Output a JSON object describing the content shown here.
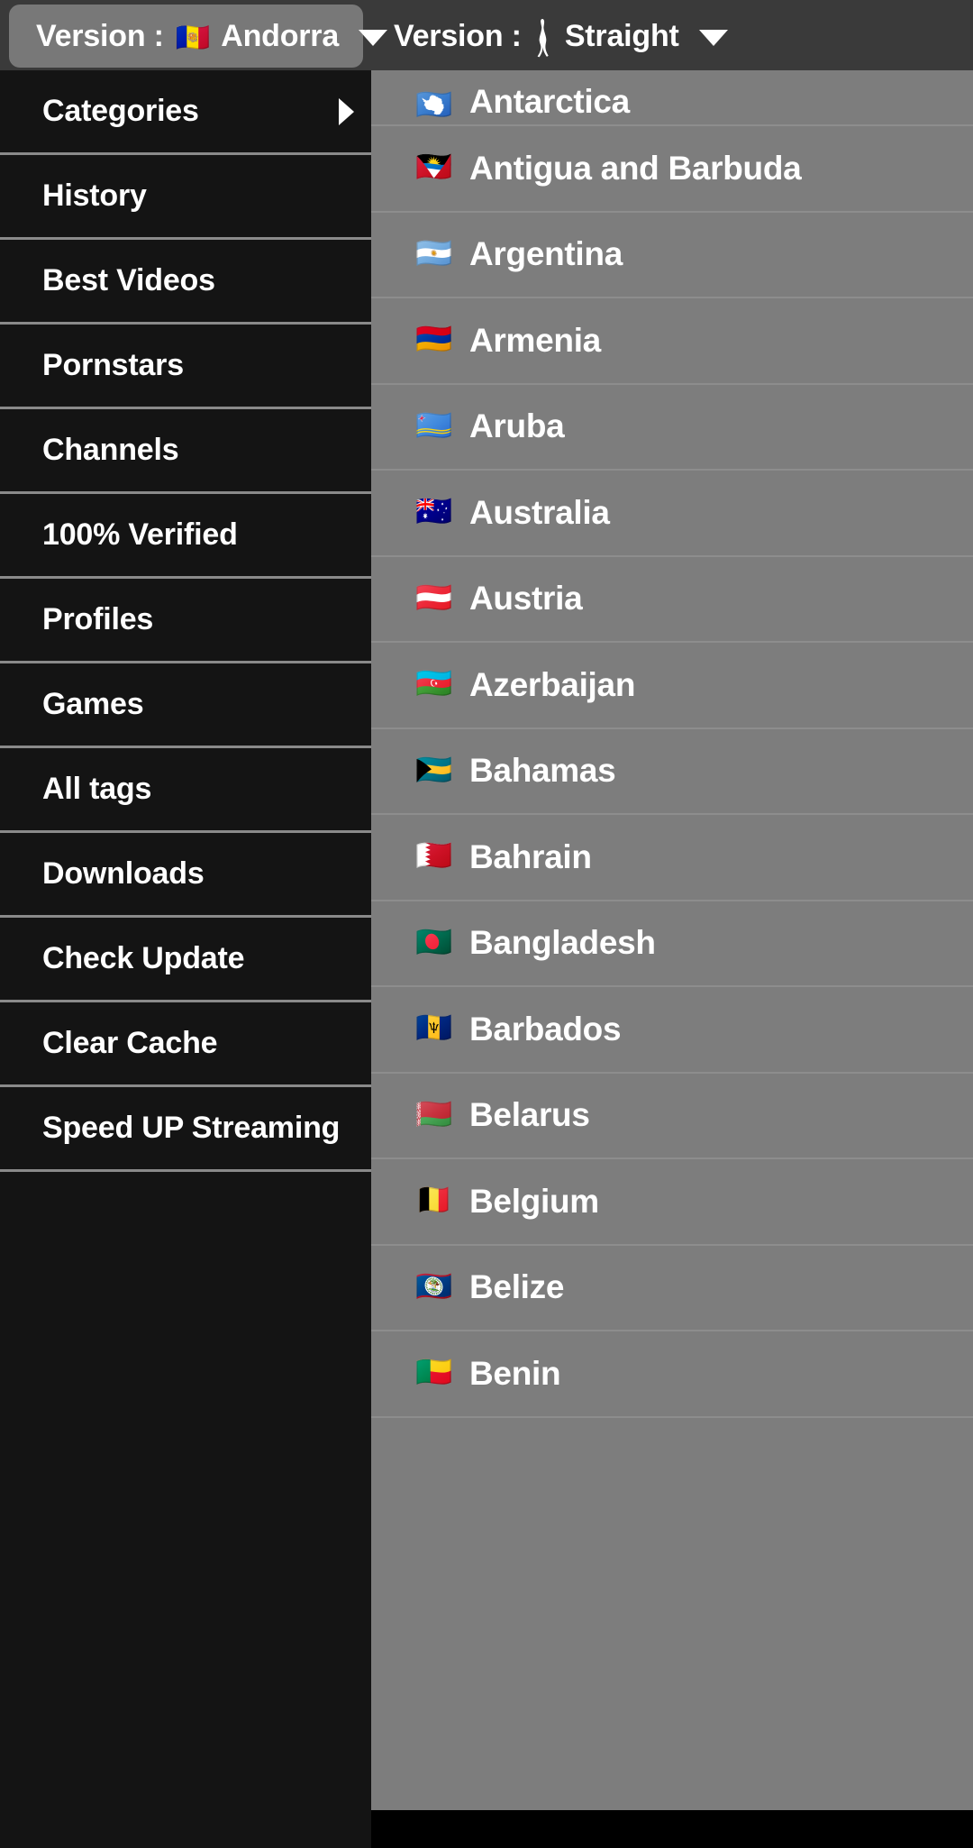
{
  "header": {
    "version_country": {
      "label": "Version :",
      "flag": "🇦🇩",
      "value": "Andorra",
      "caret": "chevron-down-icon"
    },
    "version_orientation": {
      "label": "Version :",
      "icon": "person-standing-icon",
      "value": "Straight",
      "caret": "chevron-down-icon"
    }
  },
  "sidebar": {
    "items": [
      {
        "label": "Categories",
        "has_submenu": true
      },
      {
        "label": "History",
        "has_submenu": false
      },
      {
        "label": "Best Videos",
        "has_submenu": false
      },
      {
        "label": "Pornstars",
        "has_submenu": false
      },
      {
        "label": "Channels",
        "has_submenu": false
      },
      {
        "label": "100% Verified",
        "has_submenu": false
      },
      {
        "label": "Profiles",
        "has_submenu": false
      },
      {
        "label": "Games",
        "has_submenu": false
      },
      {
        "label": "All tags",
        "has_submenu": false
      },
      {
        "label": "Downloads",
        "has_submenu": false
      },
      {
        "label": "Check Update",
        "has_submenu": false
      },
      {
        "label": "Clear Cache",
        "has_submenu": false
      },
      {
        "label": "Speed UP Streaming",
        "has_submenu": false
      }
    ]
  },
  "country_list": {
    "countries": [
      {
        "flag": "🇦🇶",
        "name": "Antarctica"
      },
      {
        "flag": "🇦🇬",
        "name": "Antigua and Barbuda"
      },
      {
        "flag": "🇦🇷",
        "name": "Argentina"
      },
      {
        "flag": "🇦🇲",
        "name": "Armenia"
      },
      {
        "flag": "🇦🇼",
        "name": "Aruba"
      },
      {
        "flag": "🇦🇺",
        "name": "Australia"
      },
      {
        "flag": "🇦🇹",
        "name": "Austria"
      },
      {
        "flag": "🇦🇿",
        "name": "Azerbaijan"
      },
      {
        "flag": "🇧🇸",
        "name": "Bahamas"
      },
      {
        "flag": "🇧🇭",
        "name": "Bahrain"
      },
      {
        "flag": "🇧🇩",
        "name": "Bangladesh"
      },
      {
        "flag": "🇧🇧",
        "name": "Barbados"
      },
      {
        "flag": "🇧🇾",
        "name": "Belarus"
      },
      {
        "flag": "🇧🇪",
        "name": "Belgium"
      },
      {
        "flag": "🇧🇿",
        "name": "Belize"
      },
      {
        "flag": "🇧🇯",
        "name": "Benin"
      }
    ]
  },
  "colors": {
    "header_bg": "#3a3a3a",
    "pill_bg": "#787878",
    "sidebar_bg": "#141414",
    "sidebar_divider": "#8a8a8a",
    "panel_bg": "#7d7d7d",
    "panel_divider": "#8d8d8d",
    "text": "#ffffff"
  }
}
